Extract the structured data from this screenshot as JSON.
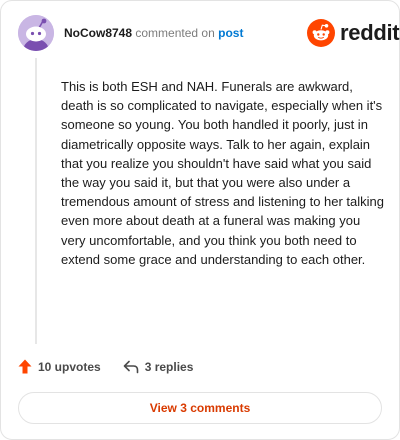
{
  "comment": {
    "username": "NoCow8748",
    "action_text": "commented on",
    "post_link_label": "post",
    "body": "This is both ESH and NAH. Funerals are awkward, death is so complicated to navigate, especially when it's someone so young. You both handled it poorly, just in diametrically opposite ways. Talk to her again, explain that you realize you shouldn't have said what you said the way you said it, but that you were also under a tremendous amount of stress and listening to her talking even more about death at a funeral was making you very uncomfortable, and you think you both need to extend some grace and understanding to each other.",
    "upvotes_label": "10 upvotes",
    "replies_label": "3 replies"
  },
  "brand": {
    "wordmark": "reddit",
    "icon": "reddit-snoo-icon",
    "color": "#ff4500"
  },
  "footer": {
    "view_comments_label": "View 3 comments"
  },
  "icons": {
    "upvote": "upvote-arrow-icon",
    "reply": "reply-arrow-icon",
    "avatar": "snoo-avatar-icon"
  },
  "colors": {
    "accent": "#d93a00",
    "upvote": "#ff4500",
    "link": "#0079d3",
    "avatar_bg": "#c9b6e4"
  }
}
